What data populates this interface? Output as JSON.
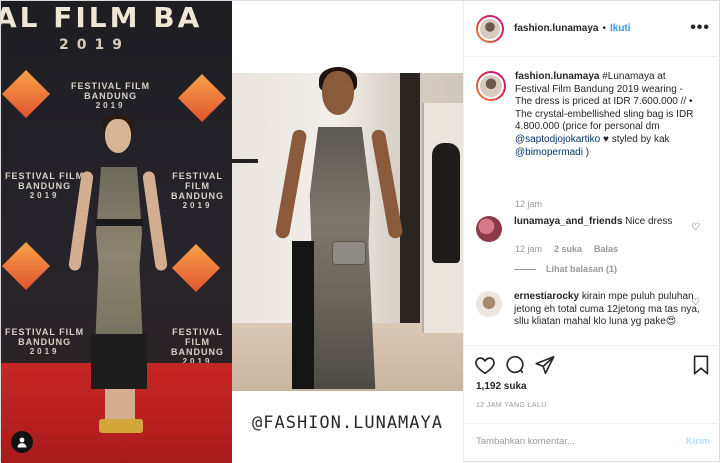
{
  "media": {
    "left_photo": {
      "banner_top": "AL FILM BA",
      "banner_year": "2019",
      "logo_line1": "FESTIVAL FILM",
      "logo_line2": "BANDUNG",
      "logo_year": "2019"
    },
    "right_photo": {
      "watermark": "@FASHION.LUNAMAYA"
    }
  },
  "header": {
    "username": "fashion.lunamaya",
    "separator": "•",
    "follow_label": "Ikuti",
    "more_icon": "more-horizontal-icon"
  },
  "caption": {
    "username": "fashion.lunamaya",
    "text_part1": "#Lunamaya at Festival Film Bandung 2019 wearing - The dress is priced at IDR 7.600.000 // • The crystal-embellished sling bag is IDR 4.800.000 (price for personal dm",
    "mention1": "@saptodjojokartiko",
    "text_part2": "♥ styled by kak",
    "mention2": "@bimopermadi",
    "text_part3": ")",
    "time": "12 jam"
  },
  "comments": [
    {
      "username": "lunamaya_and_friends",
      "text": "Nice dress",
      "time": "12 jam",
      "likes": "2 suka",
      "reply": "Balas",
      "view_replies": "Lihat balasan (1)"
    },
    {
      "username": "ernestiarocky",
      "text": "kirain mpe puluh puluhan jetong eh total cuma 12jetong ma tas nya, sllu kliatan mahal klo luna yg pake😍"
    }
  ],
  "actions": {
    "like_icon": "heart-icon",
    "comment_icon": "comment-icon",
    "share_icon": "share-icon",
    "save_icon": "bookmark-icon"
  },
  "likes_count": "1,192 suka",
  "posted_time": "12 JAM YANG LALU",
  "comment_box": {
    "placeholder": "Tambahkan komentar...",
    "submit_label": "Kirim"
  },
  "colors": {
    "link_blue": "#3897f0",
    "mention_blue": "#003569",
    "muted": "#999999",
    "border": "#efefef"
  }
}
